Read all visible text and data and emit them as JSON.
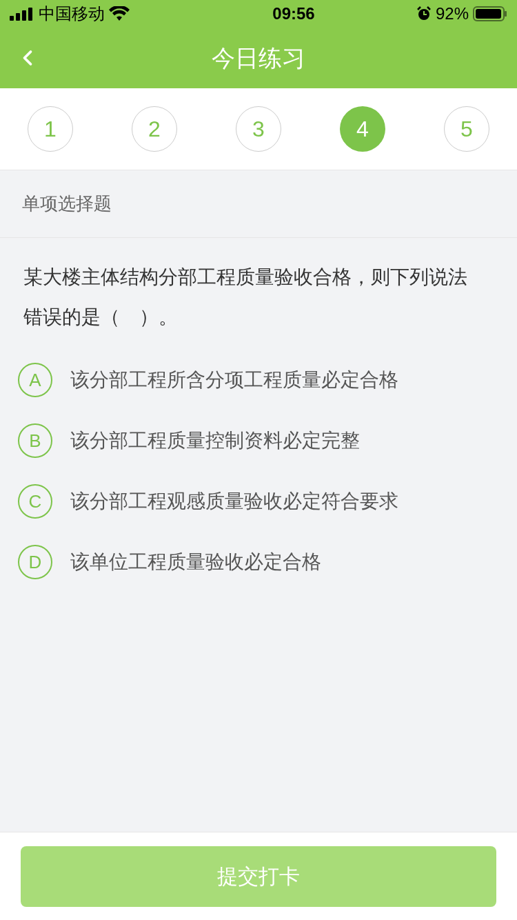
{
  "status_bar": {
    "carrier": "中国移动",
    "time": "09:56",
    "battery": "92%"
  },
  "nav": {
    "title": "今日练习"
  },
  "question_tabs": [
    {
      "label": "1",
      "selected": false
    },
    {
      "label": "2",
      "selected": false
    },
    {
      "label": "3",
      "selected": false
    },
    {
      "label": "4",
      "selected": true
    },
    {
      "label": "5",
      "selected": false
    }
  ],
  "question_type": "单项选择题",
  "question": "某大楼主体结构分部工程质量验收合格，则下列说法错误的是（　）。",
  "options": [
    {
      "letter": "A",
      "text": "该分部工程所含分项工程质量必定合格",
      "selected": false
    },
    {
      "letter": "B",
      "text": "该分部工程质量控制资料必定完整",
      "selected": false
    },
    {
      "letter": "C",
      "text": "该分部工程观感质量验收必定符合要求",
      "selected": false
    },
    {
      "letter": "D",
      "text": "该单位工程质量验收必定合格",
      "selected": false
    }
  ],
  "submit": {
    "label": "提交打卡",
    "disabled": true
  }
}
